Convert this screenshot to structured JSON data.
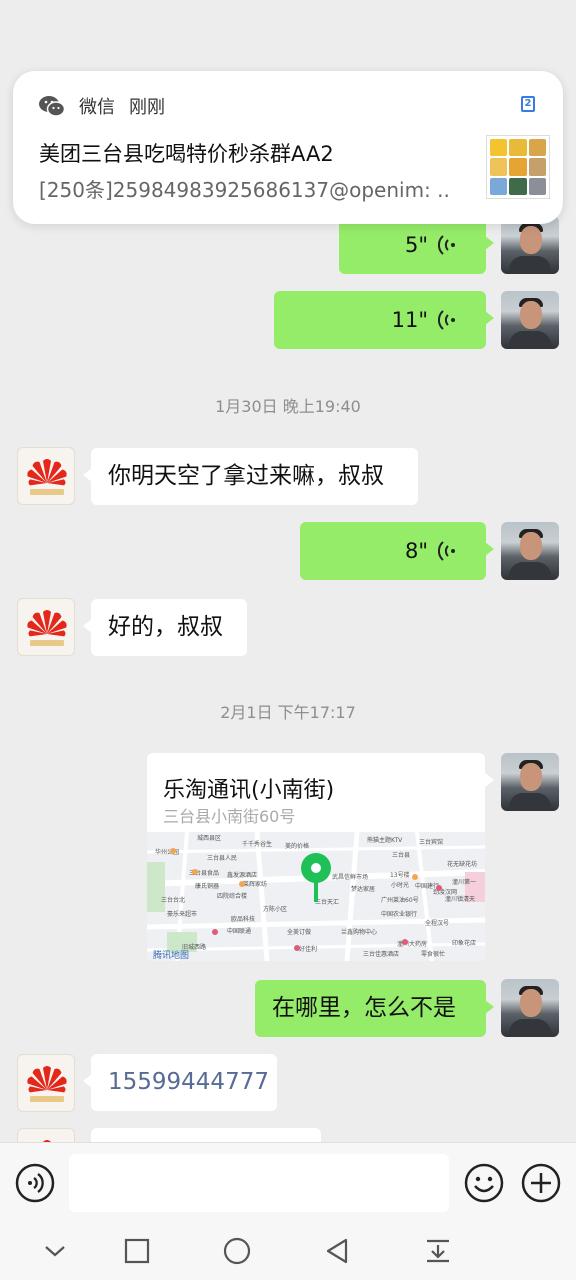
{
  "notification": {
    "app_name": "微信",
    "time": "刚刚",
    "title": "美团三台县吃喝特价秒杀群AA2",
    "text": "[250条]25984983925686137@openim: ..",
    "badge": "2",
    "app_icon": "wechat-icon"
  },
  "messages": {
    "voice1": {
      "duration": "5\""
    },
    "voice2": {
      "duration": "11\""
    },
    "time1": "1月30日 晚上19:40",
    "text1": "你明天空了拿过来嘛，叔叔",
    "voice3": {
      "duration": "8\""
    },
    "text2": "好的，叔叔",
    "time2": "2月1日 下午17:17",
    "location": {
      "name": "乐淘通讯(小南街)",
      "address": "三台县小南街60号",
      "map_watermark": "腾讯地图",
      "map_labels": [
        "城西县区",
        "千千秀谷生",
        "美的价格",
        "熊猫主题KTV",
        "三台宾馆",
        "华州公园",
        "三台县人民",
        "三台县",
        "花无缺花坊",
        "三台县食品",
        "鑫发源酒店",
        "武昌信鲜市场",
        "潼川第一",
        "康氏铜器",
        "莱辉家纺",
        "梦达家居",
        "小时光",
        "中国建行",
        "潼川镇清天",
        "四院综合楼",
        "13号楼",
        "广州莱油60号",
        "劲凌汉网",
        "三台台北",
        "方陈小区",
        "三台天汇",
        "中国农业银行",
        "全程汉号",
        "豪乐来超市",
        "欧品科技",
        "中国联通",
        "全美订做",
        "兰鑫购物中心",
        "潼川大药房",
        "印象花店",
        "旧城西路",
        "好佳利",
        "三台佳惠酒店",
        "零食很忙"
      ]
    },
    "text3": "在哪里，怎么不是",
    "text4": "15599444777"
  },
  "input": {
    "placeholder": ""
  },
  "colors": {
    "out_bubble": "#95ec69",
    "in_bubble": "#ffffff",
    "background": "#ededed",
    "map_pin": "#1fc058"
  },
  "icons": {
    "voice_toggle": "voice-mode-icon",
    "emoji": "emoji-icon",
    "plus": "plus-icon",
    "nav_back": "chevron-down-icon",
    "nav_recent": "square-icon",
    "nav_home": "circle-icon",
    "nav_triangle": "triangle-back-icon",
    "nav_download": "download-icon"
  }
}
